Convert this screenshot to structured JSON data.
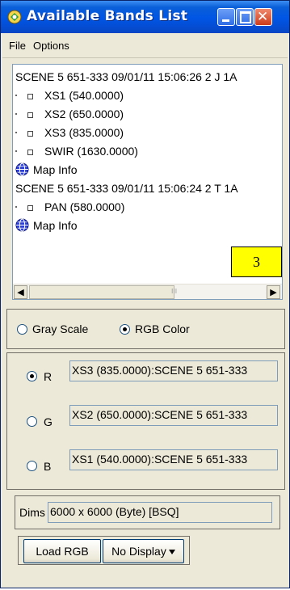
{
  "window": {
    "title": "Available Bands List"
  },
  "menu": {
    "items": [
      "File",
      "Options"
    ]
  },
  "band_list": {
    "rows": [
      {
        "kind": "scene",
        "text": "SCENE 5 651-333 09/01/11 15:06:26 2 J 1A"
      },
      {
        "kind": "band",
        "text": "XS1 (540.0000)"
      },
      {
        "kind": "band",
        "text": "XS2 (650.0000)"
      },
      {
        "kind": "band",
        "text": "XS3 (835.0000)"
      },
      {
        "kind": "band",
        "text": "SWIR (1630.0000)"
      },
      {
        "kind": "mapinfo",
        "text": "Map Info"
      },
      {
        "kind": "scene",
        "text": "SCENE 5 651-333 09/01/11 15:06:24 2 T 1A"
      },
      {
        "kind": "band",
        "text": "PAN (580.0000)"
      },
      {
        "kind": "mapinfo",
        "text": "Map Info"
      }
    ],
    "badge": "3",
    "scroll_grip": "III"
  },
  "color_mode": {
    "options": [
      "Gray Scale",
      "RGB Color"
    ],
    "selected": "RGB Color"
  },
  "rgb": {
    "channels": [
      {
        "label": "R",
        "value": "XS3 (835.0000):SCENE 5 651-333",
        "selected": true
      },
      {
        "label": "G",
        "value": "XS2 (650.0000):SCENE 5 651-333",
        "selected": false
      },
      {
        "label": "B",
        "value": "XS1 (540.0000):SCENE 5 651-333",
        "selected": false
      }
    ]
  },
  "dims": {
    "label": "Dims",
    "value": "6000 x 6000 (Byte) [BSQ]"
  },
  "actions": {
    "load_label": "Load RGB",
    "display_label": "No Display"
  },
  "colors": {
    "titlebar": "#0055e5",
    "window_bg": "#ece9d8",
    "badge": "#ffff00"
  }
}
